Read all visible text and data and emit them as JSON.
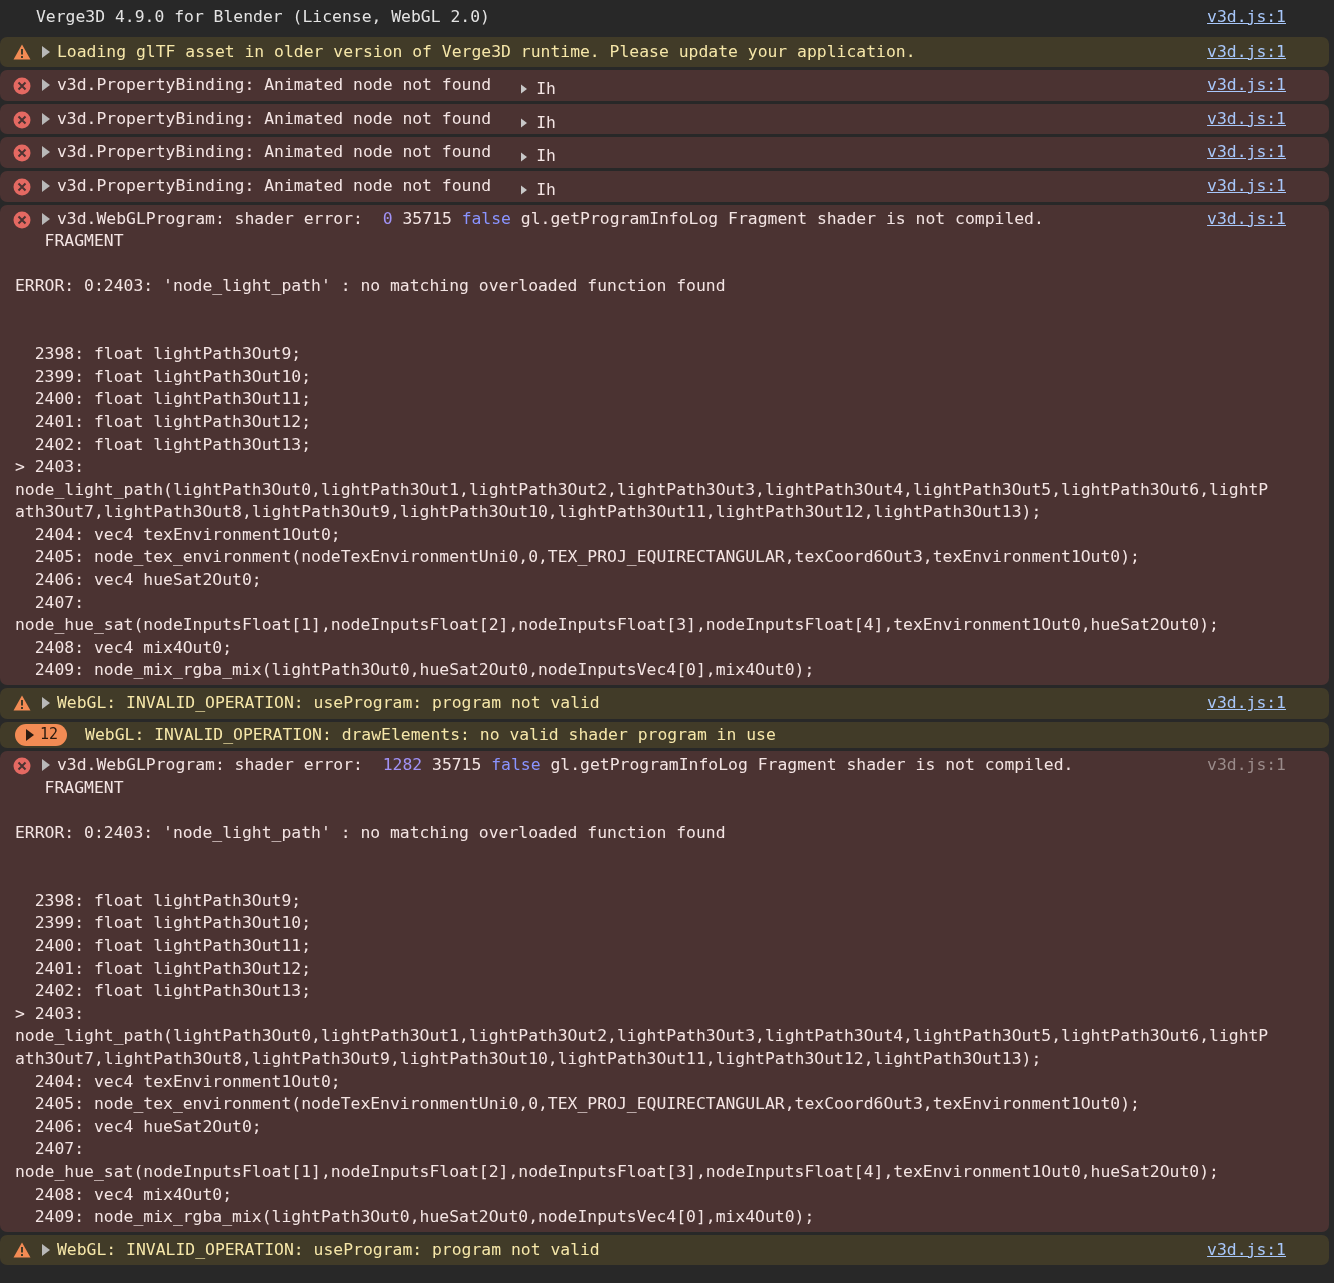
{
  "console": {
    "messages": [
      {
        "kind": "info",
        "text": "Verge3D 4.9.0 for Blender (License, WebGL 2.0)",
        "source": "v3d.js:1",
        "source_linked": true
      },
      {
        "kind": "warning",
        "text": "Loading glTF asset in older version of Verge3D runtime. Please update your application.",
        "source": "v3d.js:1",
        "source_linked": true
      },
      {
        "kind": "error",
        "text": "v3d.PropertyBinding: Animated node not found",
        "object_preview": "Ih",
        "source": "v3d.js:1",
        "source_linked": true
      },
      {
        "kind": "error",
        "text": "v3d.PropertyBinding: Animated node not found",
        "object_preview": "Ih",
        "source": "v3d.js:1",
        "source_linked": true
      },
      {
        "kind": "error",
        "text": "v3d.PropertyBinding: Animated node not found",
        "object_preview": "Ih",
        "source": "v3d.js:1",
        "source_linked": true
      },
      {
        "kind": "error",
        "text": "v3d.PropertyBinding: Animated node not found",
        "object_preview": "Ih",
        "source": "v3d.js:1",
        "source_linked": true
      },
      {
        "kind": "error",
        "text": "v3d.WebGLProgram: shader error: ",
        "args": [
          {
            "kind": "number",
            "text": "0"
          },
          {
            "kind": "plain",
            "text": "35715"
          },
          {
            "kind": "keyword",
            "text": "false"
          },
          {
            "kind": "plain",
            "text": "gl.getProgramInfoLog Fragment shader is not compiled."
          }
        ],
        "details": "   FRAGMENT\n\nERROR: 0:2403: 'node_light_path' : no matching overloaded function found\n\n\n  2398: float lightPath3Out9;\n  2399: float lightPath3Out10;\n  2400: float lightPath3Out11;\n  2401: float lightPath3Out12;\n  2402: float lightPath3Out13;\n> 2403:\nnode_light_path(lightPath3Out0,lightPath3Out1,lightPath3Out2,lightPath3Out3,lightPath3Out4,lightPath3Out5,lightPath3Out6,lightP\nath3Out7,lightPath3Out8,lightPath3Out9,lightPath3Out10,lightPath3Out11,lightPath3Out12,lightPath3Out13);\n  2404: vec4 texEnvironment1Out0;\n  2405: node_tex_environment(nodeTexEnvironmentUni0,0,TEX_PROJ_EQUIRECTANGULAR,texCoord6Out3,texEnvironment1Out0);\n  2406: vec4 hueSat2Out0;\n  2407:\nnode_hue_sat(nodeInputsFloat[1],nodeInputsFloat[2],nodeInputsFloat[3],nodeInputsFloat[4],texEnvironment1Out0,hueSat2Out0);\n  2408: vec4 mix4Out0;\n  2409: node_mix_rgba_mix(lightPath3Out0,hueSat2Out0,nodeInputsVec4[0],mix4Out0);",
        "source": "v3d.js:1",
        "source_linked": true
      },
      {
        "kind": "warning",
        "text": "WebGL: INVALID_OPERATION: useProgram: program not valid",
        "source": "v3d.js:1",
        "source_linked": true
      },
      {
        "kind": "repeated",
        "count": "12",
        "text": "WebGL: INVALID_OPERATION: drawElements: no valid shader program in use"
      },
      {
        "kind": "error",
        "text": "v3d.WebGLProgram: shader error: ",
        "args": [
          {
            "kind": "number",
            "text": "1282"
          },
          {
            "kind": "plain",
            "text": "35715"
          },
          {
            "kind": "keyword",
            "text": "false"
          },
          {
            "kind": "plain",
            "text": "gl.getProgramInfoLog Fragment shader is not compiled."
          }
        ],
        "details": "   FRAGMENT\n\nERROR: 0:2403: 'node_light_path' : no matching overloaded function found\n\n\n  2398: float lightPath3Out9;\n  2399: float lightPath3Out10;\n  2400: float lightPath3Out11;\n  2401: float lightPath3Out12;\n  2402: float lightPath3Out13;\n> 2403:\nnode_light_path(lightPath3Out0,lightPath3Out1,lightPath3Out2,lightPath3Out3,lightPath3Out4,lightPath3Out5,lightPath3Out6,lightP\nath3Out7,lightPath3Out8,lightPath3Out9,lightPath3Out10,lightPath3Out11,lightPath3Out12,lightPath3Out13);\n  2404: vec4 texEnvironment1Out0;\n  2405: node_tex_environment(nodeTexEnvironmentUni0,0,TEX_PROJ_EQUIRECTANGULAR,texCoord6Out3,texEnvironment1Out0);\n  2406: vec4 hueSat2Out0;\n  2407:\nnode_hue_sat(nodeInputsFloat[1],nodeInputsFloat[2],nodeInputsFloat[3],nodeInputsFloat[4],texEnvironment1Out0,hueSat2Out0);\n  2408: vec4 mix4Out0;\n  2409: node_mix_rgba_mix(lightPath3Out0,hueSat2Out0,nodeInputsVec4[0],mix4Out0);",
        "source": "v3d.js:1",
        "source_linked": false
      },
      {
        "kind": "warning",
        "text": "WebGL: INVALID_OPERATION: useProgram: program not valid",
        "source": "v3d.js:1",
        "source_linked": true
      }
    ]
  }
}
